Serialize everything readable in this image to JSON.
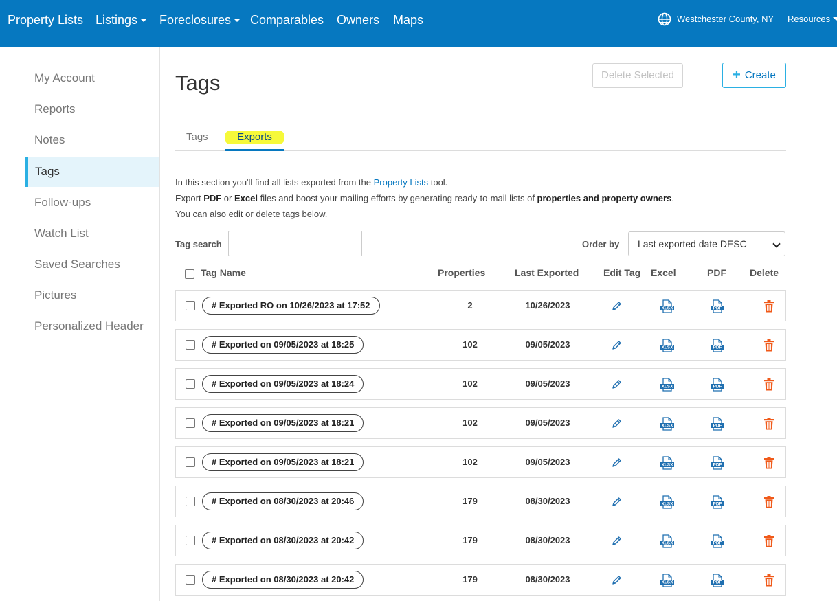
{
  "nav": {
    "items": [
      {
        "label": "Property Lists",
        "dropdown": false
      },
      {
        "label": "Listings",
        "dropdown": true
      },
      {
        "label": "Foreclosures",
        "dropdown": true
      },
      {
        "label": "Comparables",
        "dropdown": false
      },
      {
        "label": "Owners",
        "dropdown": false
      },
      {
        "label": "Maps",
        "dropdown": false
      }
    ],
    "location": "Westchester County, NY",
    "resources": "Resources"
  },
  "sidebar": {
    "items": [
      {
        "label": "My Account"
      },
      {
        "label": "Reports"
      },
      {
        "label": "Notes"
      },
      {
        "label": "Tags"
      },
      {
        "label": "Follow-ups"
      },
      {
        "label": "Watch List"
      },
      {
        "label": "Saved Searches"
      },
      {
        "label": "Pictures"
      },
      {
        "label": "Personalized Header"
      }
    ],
    "active": "Tags"
  },
  "page": {
    "title": "Tags",
    "delete_selected": "Delete Selected",
    "create": "Create"
  },
  "tabs": [
    {
      "label": "Tags",
      "active": false
    },
    {
      "label": "Exports",
      "active": true
    }
  ],
  "description": {
    "line1_pre": "In this section you'll find all lists exported from the ",
    "line1_link": "Property Lists",
    "line1_post": " tool.",
    "line2_a": "Export ",
    "line2_b": "PDF",
    "line2_c": " or ",
    "line2_d": "Excel",
    "line2_e": " files and boost your mailing efforts by generating ready-to-mail lists of ",
    "line2_f": "properties and property owners",
    "line2_g": ".",
    "line3": "You can also edit or delete tags below."
  },
  "filters": {
    "tag_search_label": "Tag search",
    "tag_search_value": "",
    "order_by_label": "Order by",
    "order_by_value": "Last exported date DESC"
  },
  "table": {
    "headers": {
      "tag_name": "Tag Name",
      "properties": "Properties",
      "last_exported": "Last Exported",
      "edit_tag": "Edit Tag",
      "excel": "Excel",
      "pdf": "PDF",
      "delete": "Delete"
    },
    "rows": [
      {
        "tag": "# Exported RO on 10/26/2023 at 17:52",
        "properties": "2",
        "last_exported": "10/26/2023"
      },
      {
        "tag": "# Exported on 09/05/2023 at 18:25",
        "properties": "102",
        "last_exported": "09/05/2023"
      },
      {
        "tag": "# Exported on 09/05/2023 at 18:24",
        "properties": "102",
        "last_exported": "09/05/2023"
      },
      {
        "tag": "# Exported on 09/05/2023 at 18:21",
        "properties": "102",
        "last_exported": "09/05/2023"
      },
      {
        "tag": "# Exported on 09/05/2023 at 18:21",
        "properties": "102",
        "last_exported": "09/05/2023"
      },
      {
        "tag": "# Exported on 08/30/2023 at 20:46",
        "properties": "179",
        "last_exported": "08/30/2023"
      },
      {
        "tag": "# Exported on 08/30/2023 at 20:42",
        "properties": "179",
        "last_exported": "08/30/2023"
      },
      {
        "tag": "# Exported on 08/30/2023 at 20:42",
        "properties": "179",
        "last_exported": "08/30/2023"
      }
    ]
  },
  "icons": {
    "excel_text": "XLSX",
    "pdf_text": "PDF"
  },
  "colors": {
    "nav_bg": "#0678c0",
    "accent": "#2bb0e3",
    "delete_icon": "#f05a1a",
    "file_icon": "#1f6fb0",
    "highlight": "#f6f93a"
  }
}
